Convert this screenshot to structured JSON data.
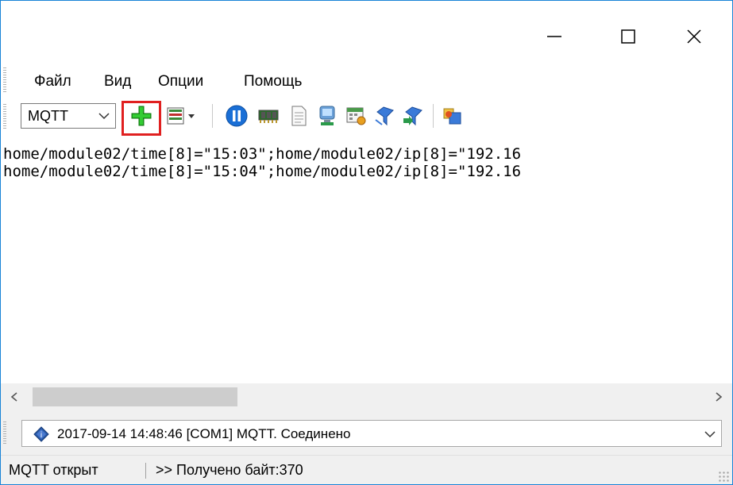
{
  "window": {
    "controls": {
      "minimize": "—",
      "maximize": "☐",
      "close": "✕"
    }
  },
  "menu": {
    "items": [
      "Файл",
      "Вид",
      "Опции",
      "Помощь"
    ]
  },
  "toolbar": {
    "protocol_selected": "MQTT",
    "buttons": [
      "add-icon",
      "list-view-icon",
      "pause-icon",
      "memory-chip-icon",
      "document-icon",
      "computer-icon",
      "calculator-icon",
      "filter-icon",
      "filter-edit-icon",
      "export-icon"
    ],
    "colors": {
      "add": "#22aa22",
      "pause": "#1a6fd6",
      "highlight": "#e02020"
    }
  },
  "terminal": {
    "lines": [
      "home/module02/time[8]=\"15:03\";home/module02/ip[8]=\"192.16",
      "home/module02/time[8]=\"15:04\";home/module02/ip[8]=\"192.16"
    ]
  },
  "log": {
    "entry": "2017-09-14 14:48:46 [COM1] MQTT. Соединено"
  },
  "status": {
    "left": "MQTT открыт",
    "right": ">> Получено байт:370"
  }
}
